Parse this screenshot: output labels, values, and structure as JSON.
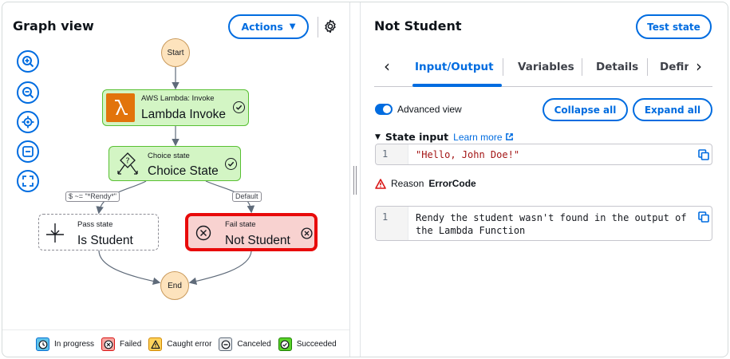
{
  "left_panel": {
    "title": "Graph view",
    "actions_label": "Actions"
  },
  "graph": {
    "start_label": "Start",
    "end_label": "End",
    "task_node": {
      "type_label": "AWS Lambda: Invoke",
      "name": "Lambda Invoke",
      "status": "succeeded"
    },
    "choice_node": {
      "type_label": "Choice state",
      "name": "Choice State",
      "status": "succeeded"
    },
    "pass_node": {
      "type_label": "Pass state",
      "name": "Is Student"
    },
    "fail_node": {
      "type_label": "Fail state",
      "name": "Not Student",
      "status": "failed"
    },
    "edge_labels": {
      "choice_rule": "$ ~= \"*Rendy*\"",
      "default": "Default"
    }
  },
  "legend": [
    {
      "label": "In progress",
      "icon": "clock-icon",
      "color": "#0972d3"
    },
    {
      "label": "Failed",
      "icon": "x-circle-icon",
      "color": "#d91515"
    },
    {
      "label": "Caught error",
      "icon": "warning-icon",
      "color": "#ffb600"
    },
    {
      "label": "Canceled",
      "icon": "minus-circle-icon",
      "color": "#414d5c"
    },
    {
      "label": "Succeeded",
      "icon": "check-circle-icon",
      "color": "#1d8102"
    }
  ],
  "right_panel": {
    "title": "Not Student",
    "test_state_label": "Test state",
    "tabs": [
      {
        "label": "Input/Output",
        "active": true
      },
      {
        "label": "Variables",
        "active": false
      },
      {
        "label": "Details",
        "active": false
      },
      {
        "label": "Definition",
        "active": false
      }
    ],
    "advanced_view_label": "Advanced view",
    "advanced_view_on": true,
    "collapse_all_label": "Collapse all",
    "expand_all_label": "Expand all",
    "state_input": {
      "heading": "State input",
      "learn_more_label": "Learn more",
      "line_number": "1",
      "value": "\"Hello, John Doe!\""
    },
    "reason": {
      "label": "Reason",
      "code": "ErrorCode"
    },
    "cause": {
      "line_number": "1",
      "line1": "Rendy the student wasn't found in the output of",
      "line2": "the Lambda Function"
    }
  },
  "colors": {
    "accent": "#006ce0",
    "success_fill": "#d3f5c4",
    "success_border": "#58c033",
    "failed_fill": "#f8d2d0",
    "failed_border": "#e80a0a",
    "terminal_fill": "#fde3bd",
    "lambda_orange": "#e2740b"
  }
}
